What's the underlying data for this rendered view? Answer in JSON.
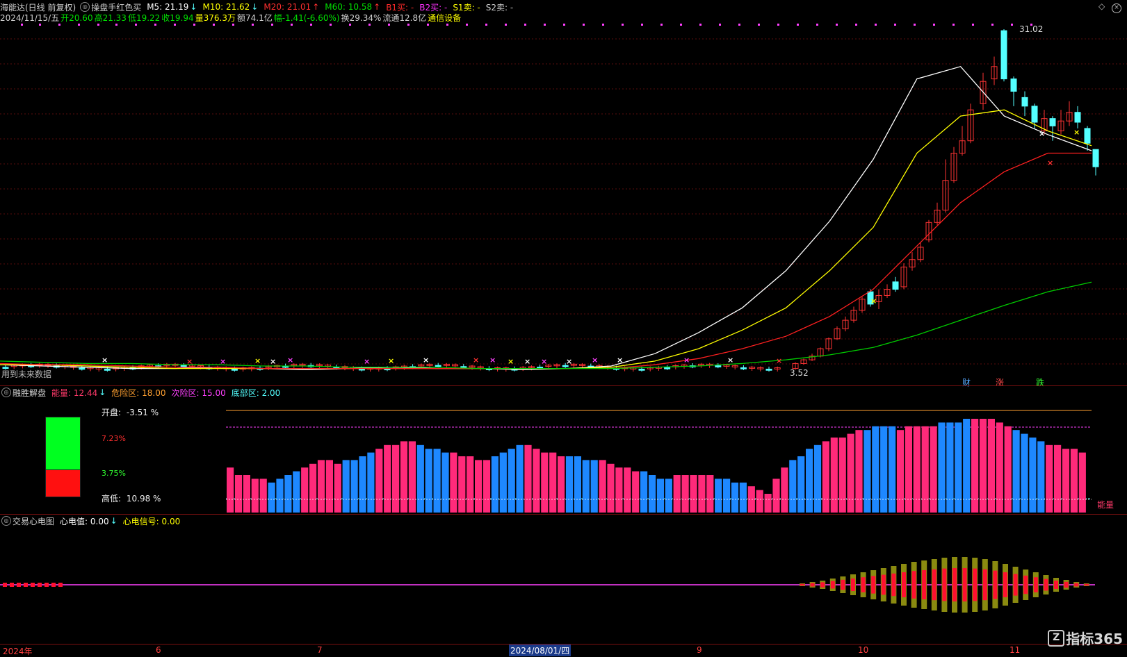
{
  "header": {
    "stock_name": "海能达(日线 前复权)",
    "formula_name": "操盘手红色买",
    "m5": "M5: 21.19",
    "m10": "M10: 21.62",
    "m20": "M20: 21.01",
    "m60": "M60: 10.58",
    "b1": "B1买: -",
    "b2": "B2买: -",
    "s1": "S1卖: -",
    "s2": "S2卖: -",
    "date": "2024/11/15/五",
    "open": "开20.60",
    "high": "高21.33",
    "low": "低19.22",
    "close": "收19.94",
    "volume": "量376.3万",
    "amount": "额74.1亿",
    "change": "幅-1.41(-6.60%)",
    "turnover": "换29.34%",
    "float_cap": "流通12.8亿",
    "sector": "通信设备"
  },
  "main_chart": {
    "high_label": "31.02",
    "low_label": "3.52",
    "warning": "用到未来数据",
    "tags": [
      "财",
      "涨",
      "跌"
    ]
  },
  "panel2": {
    "name": "融胜解盘",
    "energy": "能量: 12.44",
    "danger": "危险区: 18.00",
    "secondary": "次险区: 15.00",
    "bottom": "底部区: 2.00",
    "open_label": "开盘:",
    "open_value": "-3.51 %",
    "red_pct": "7.23%",
    "green_pct": "3.75%",
    "highlow_label": "高低:",
    "highlow_value": "10.98 %",
    "energy_side": "能量"
  },
  "panel3": {
    "name": "交易心电图",
    "value": "心电值: 0.00",
    "signal": "心电信号: 0.00"
  },
  "timeline": {
    "labels": [
      "2024年",
      "6",
      "7",
      "2024/08/01/四",
      "9",
      "10",
      "11"
    ]
  },
  "watermark": "指标365",
  "colors": {
    "up": "#ff3333",
    "down": "#54ffff",
    "ma5": "#ffffff",
    "ma10": "#ffff00",
    "ma20": "#ff2020",
    "ma60": "#00cc00",
    "bar_pink": "#ff2a7a",
    "bar_blue": "#1e88ff"
  },
  "chart_data": {
    "type": "line",
    "title": "海能达(日线 前复权)",
    "series": [
      {
        "name": "M5",
        "values": [
          3.9,
          3.8,
          3.7,
          3.6,
          3.6,
          3.7,
          3.6,
          3.5,
          3.6,
          3.7,
          3.6,
          3.6,
          3.5,
          3.6,
          3.8,
          4.8,
          6.5,
          8.5,
          11.5,
          15.5,
          20.5,
          27.0,
          28.0,
          24.0,
          22.5,
          21.2
        ]
      },
      {
        "name": "M10",
        "values": [
          3.9,
          3.9,
          3.8,
          3.7,
          3.6,
          3.6,
          3.6,
          3.6,
          3.6,
          3.6,
          3.6,
          3.6,
          3.6,
          3.6,
          3.7,
          4.2,
          5.2,
          6.7,
          8.5,
          11.5,
          15.0,
          21.0,
          24.0,
          24.5,
          22.8,
          21.6
        ]
      },
      {
        "name": "M20",
        "values": [
          4.0,
          3.9,
          3.9,
          3.8,
          3.7,
          3.7,
          3.6,
          3.6,
          3.6,
          3.6,
          3.6,
          3.6,
          3.6,
          3.6,
          3.6,
          3.9,
          4.4,
          5.2,
          6.2,
          7.8,
          10.0,
          13.5,
          17.0,
          19.5,
          21.0,
          21.0
        ]
      },
      {
        "name": "M60",
        "values": [
          4.2,
          4.1,
          4.0,
          4.0,
          3.9,
          3.9,
          3.8,
          3.8,
          3.7,
          3.7,
          3.7,
          3.6,
          3.6,
          3.6,
          3.6,
          3.7,
          3.8,
          4.0,
          4.3,
          4.7,
          5.3,
          6.3,
          7.5,
          8.7,
          9.8,
          10.58
        ]
      }
    ],
    "ylim": [
      3.52,
      31.02
    ]
  }
}
